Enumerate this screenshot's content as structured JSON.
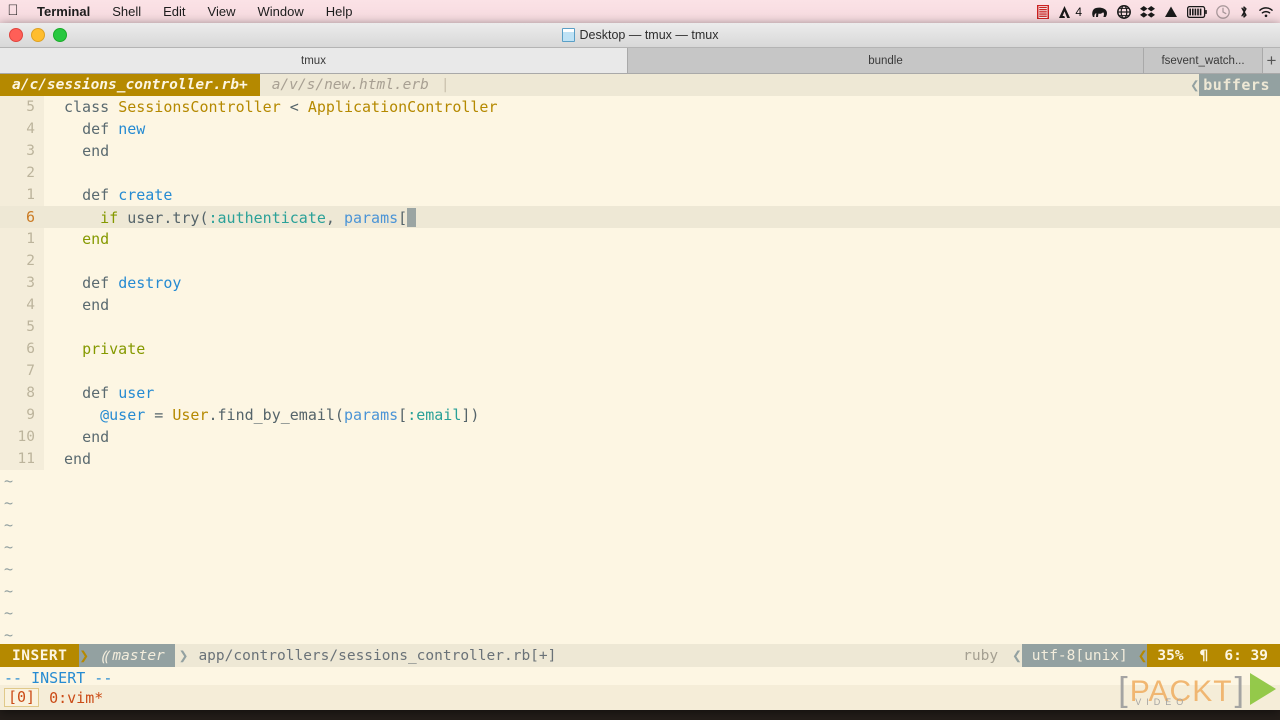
{
  "menubar": {
    "apple": "",
    "items": [
      {
        "label": "Terminal",
        "bold": true
      },
      {
        "label": "Shell",
        "bold": false
      },
      {
        "label": "Edit",
        "bold": false
      },
      {
        "label": "View",
        "bold": false
      },
      {
        "label": "Window",
        "bold": false
      },
      {
        "label": "Help",
        "bold": false
      }
    ],
    "status_icons": [
      {
        "name": "film-strip-icon",
        "glyph": "‖"
      },
      {
        "name": "adobe-icon",
        "glyph": "◤"
      },
      {
        "name": "space-count-label",
        "glyph": "4"
      },
      {
        "name": "elephant-icon",
        "glyph": "●"
      },
      {
        "name": "globe-icon",
        "glyph": "⊕"
      },
      {
        "name": "dropbox-icon",
        "glyph": "❖"
      },
      {
        "name": "google-drive-icon",
        "glyph": "△"
      },
      {
        "name": "battery-icon",
        "glyph": "▤"
      },
      {
        "name": "time-machine-icon",
        "glyph": "↺"
      },
      {
        "name": "bluetooth-icon",
        "glyph": "✶"
      },
      {
        "name": "wifi-icon",
        "glyph": "◔"
      }
    ],
    "space_count": "4"
  },
  "window": {
    "title": "Desktop — tmux — tmux",
    "traffic_lights": [
      "close",
      "minimize",
      "zoom"
    ]
  },
  "tabstrip": {
    "tabs": [
      {
        "label": "tmux",
        "active": true
      },
      {
        "label": "bundle",
        "active": false
      },
      {
        "label": "fsevent_watch...",
        "active": false
      }
    ],
    "new_tab_label": "+"
  },
  "vim": {
    "tabline": {
      "buffers": [
        {
          "label": "a/c/sessions_controller.rb+",
          "active": true
        },
        {
          "label": "a/v/s/new.html.erb",
          "active": false
        }
      ],
      "separator": "|",
      "right_arrow": "❮",
      "right_label": "buffers"
    },
    "lines": [
      {
        "num": "5",
        "cursor": false,
        "indent": 0,
        "tokens": [
          {
            "t": "class ",
            "c": "c-kw"
          },
          {
            "t": "SessionsController",
            "c": "c-const"
          },
          {
            "t": " < ",
            "c": "c-op"
          },
          {
            "t": "ApplicationController",
            "c": "c-const"
          }
        ]
      },
      {
        "num": "4",
        "cursor": false,
        "indent": 1,
        "tokens": [
          {
            "t": "def ",
            "c": "c-kw"
          },
          {
            "t": "new",
            "c": "c-method"
          }
        ]
      },
      {
        "num": "3",
        "cursor": false,
        "indent": 1,
        "tokens": [
          {
            "t": "end",
            "c": "c-kw"
          }
        ]
      },
      {
        "num": "2",
        "cursor": false,
        "indent": 0,
        "tokens": []
      },
      {
        "num": "1",
        "cursor": false,
        "indent": 1,
        "tokens": [
          {
            "t": "def ",
            "c": "c-kw"
          },
          {
            "t": "create",
            "c": "c-method"
          }
        ]
      },
      {
        "num": "6",
        "cursor": true,
        "indent": 2,
        "tokens": [
          {
            "t": "if ",
            "c": "c-cond"
          },
          {
            "t": "user.try(",
            "c": "c-plain"
          },
          {
            "t": ":authenticate",
            "c": "c-sym"
          },
          {
            "t": ", ",
            "c": "c-plain"
          },
          {
            "t": "params",
            "c": "c-ident"
          },
          {
            "t": "[",
            "c": "c-plain"
          }
        ],
        "cursor_block": true
      },
      {
        "num": "1",
        "cursor": false,
        "indent": 1,
        "tokens": [
          {
            "t": "end",
            "c": "c-cond"
          }
        ]
      },
      {
        "num": "2",
        "cursor": false,
        "indent": 0,
        "tokens": []
      },
      {
        "num": "3",
        "cursor": false,
        "indent": 1,
        "tokens": [
          {
            "t": "def ",
            "c": "c-kw"
          },
          {
            "t": "destroy",
            "c": "c-method"
          }
        ]
      },
      {
        "num": "4",
        "cursor": false,
        "indent": 1,
        "tokens": [
          {
            "t": "end",
            "c": "c-kw"
          }
        ]
      },
      {
        "num": "5",
        "cursor": false,
        "indent": 0,
        "tokens": []
      },
      {
        "num": "6",
        "cursor": false,
        "indent": 1,
        "tokens": [
          {
            "t": "private",
            "c": "c-cond"
          }
        ]
      },
      {
        "num": "7",
        "cursor": false,
        "indent": 0,
        "tokens": []
      },
      {
        "num": "8",
        "cursor": false,
        "indent": 1,
        "tokens": [
          {
            "t": "def ",
            "c": "c-kw"
          },
          {
            "t": "user",
            "c": "c-method"
          }
        ]
      },
      {
        "num": "9",
        "cursor": false,
        "indent": 2,
        "tokens": [
          {
            "t": "@user",
            "c": "c-ivar"
          },
          {
            "t": " = ",
            "c": "c-op"
          },
          {
            "t": "User",
            "c": "c-const"
          },
          {
            "t": ".find_by_email(",
            "c": "c-plain"
          },
          {
            "t": "params",
            "c": "c-ident"
          },
          {
            "t": "[",
            "c": "c-plain"
          },
          {
            "t": ":email",
            "c": "c-sym"
          },
          {
            "t": "])",
            "c": "c-plain"
          }
        ]
      },
      {
        "num": "10",
        "cursor": false,
        "indent": 1,
        "tokens": [
          {
            "t": "end",
            "c": "c-kw"
          }
        ]
      },
      {
        "num": "11",
        "cursor": false,
        "indent": 0,
        "tokens": [
          {
            "t": "end",
            "c": "c-kw"
          }
        ]
      }
    ],
    "empty_marker": "~",
    "empty_line_count": 8,
    "statusline": {
      "mode": "INSERT",
      "branch_icon": "⸨",
      "branch": "master",
      "file": "app/controllers/sessions_controller.rb[+]",
      "filetype": "ruby",
      "encoding": "utf-8[unix]",
      "percent": "35%",
      "paragraph_glyph": "¶",
      "position": "6: 39",
      "arrow": "❯",
      "arrow_left": "❮"
    },
    "cmdline": "-- INSERT --"
  },
  "tmux_status": {
    "session": "[0]",
    "window": "0:vim*"
  },
  "logo": {
    "bracket_left": "[",
    "word": "PACKT",
    "bracket_right": "]",
    "subtitle": "VIDEO"
  },
  "colors": {
    "accent_yellow": "#b58900",
    "slate": "#93a1a1",
    "bg": "#fdf6e3",
    "bg_alt": "#eee8d5",
    "orange": "#cb4b16",
    "blue": "#268bd2",
    "green": "#859900",
    "cyan": "#2aa198"
  }
}
